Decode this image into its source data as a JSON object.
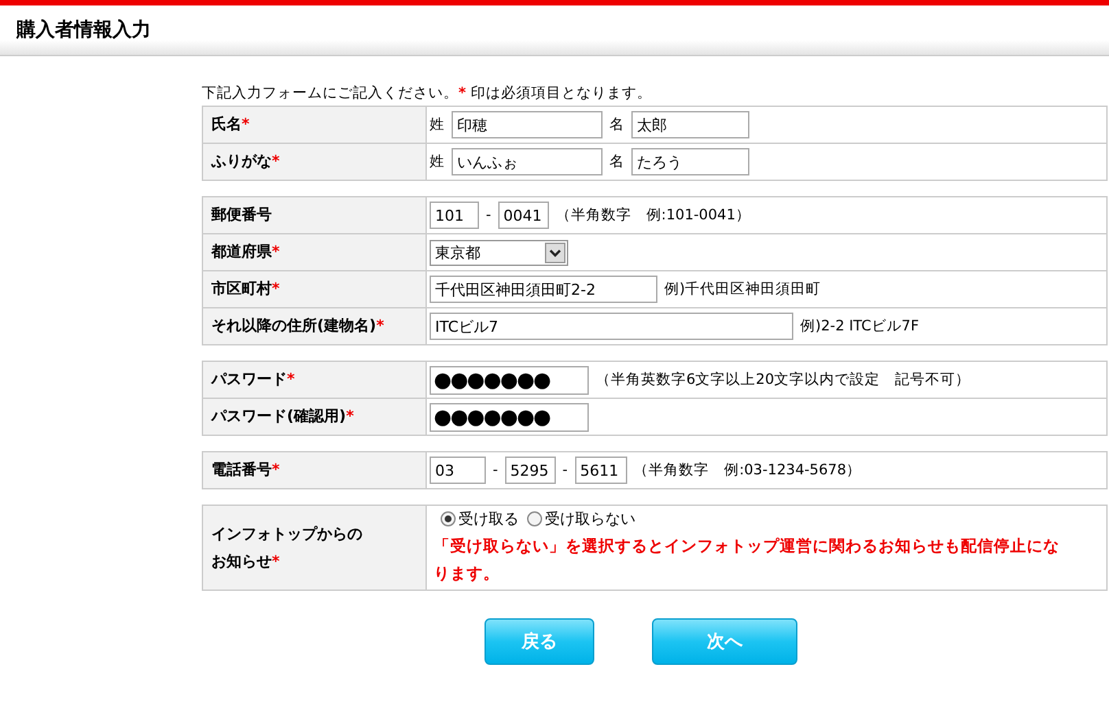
{
  "page_title": "購入者情報入力",
  "intro": [
    {
      "kind": "text",
      "text": "下記入力フォームにご記入ください。"
    },
    {
      "kind": "mark",
      "text": "*"
    },
    {
      "kind": "text",
      "text": " 印は必須項目となります。"
    }
  ],
  "groups": [
    {
      "rows": [
        {
          "label": "氏名",
          "required_mark": "*",
          "items": [
            {
              "kind": "text",
              "text": "姓"
            },
            {
              "kind": "input",
              "value": "印穂"
            },
            {
              "kind": "text",
              "text": "名"
            },
            {
              "kind": "input",
              "value": "太郎"
            }
          ]
        },
        {
          "label": "ふりがな",
          "required_mark": "*",
          "items": [
            {
              "kind": "text",
              "text": "姓"
            },
            {
              "kind": "input",
              "value": "いんふぉ"
            },
            {
              "kind": "text",
              "text": "名"
            },
            {
              "kind": "input",
              "value": "たろう"
            }
          ]
        }
      ]
    },
    {
      "rows": [
        {
          "label": "郵便番号",
          "items": [
            {
              "kind": "input",
              "value": "101"
            },
            {
              "kind": "text",
              "text": "-"
            },
            {
              "kind": "input",
              "value": "0041"
            },
            {
              "kind": "text",
              "text": "（半角数字　例:101-0041）"
            }
          ]
        },
        {
          "label": "都道府県",
          "required_mark": "*",
          "items": [
            {
              "kind": "select",
              "value": "東京都"
            }
          ]
        },
        {
          "label": "市区町村",
          "required_mark": "*",
          "items": [
            {
              "kind": "input",
              "value": "千代田区神田須田町2-2"
            },
            {
              "kind": "text",
              "text": "例)千代田区神田須田町"
            }
          ]
        },
        {
          "label": "それ以降の住所(建物名)",
          "required_mark": "*",
          "items": [
            {
              "kind": "input",
              "value": "ITCビル7"
            },
            {
              "kind": "text",
              "text": "例)2-2 ITCビル7F"
            }
          ]
        }
      ]
    },
    {
      "rows": [
        {
          "label": "パスワード",
          "required_mark": "*",
          "items": [
            {
              "kind": "password",
              "value": "●●●●●●●"
            },
            {
              "kind": "text",
              "text": "（半角英数字6文字以上20文字以内で設定　記号不可）"
            }
          ]
        },
        {
          "label": "パスワード(確認用)",
          "required_mark": "*",
          "items": [
            {
              "kind": "password",
              "value": "●●●●●●●"
            }
          ]
        }
      ]
    },
    {
      "rows": [
        {
          "label": "電話番号",
          "required_mark": "*",
          "items": [
            {
              "kind": "input",
              "value": "03"
            },
            {
              "kind": "text",
              "text": "-"
            },
            {
              "kind": "input",
              "value": "5295"
            },
            {
              "kind": "text",
              "text": "-"
            },
            {
              "kind": "input",
              "value": "5611"
            },
            {
              "kind": "text",
              "text": "（半角数字　例:03-1234-5678）"
            }
          ]
        }
      ]
    },
    {
      "rows": [
        {
          "label": "インフォトップからのお知らせ",
          "required_mark": "*",
          "items": [
            {
              "kind": "radios",
              "options": [
                {
                  "label": "受け取る",
                  "selected": true
                },
                {
                  "label": "受け取らない",
                  "selected": false
                }
              ]
            },
            {
              "kind": "note",
              "text": "「受け取らない」を選択するとインフォトップ運営に関わるお知らせも配信停止になります。"
            }
          ]
        }
      ]
    }
  ],
  "buttons": [
    "戻る",
    "次へ"
  ]
}
